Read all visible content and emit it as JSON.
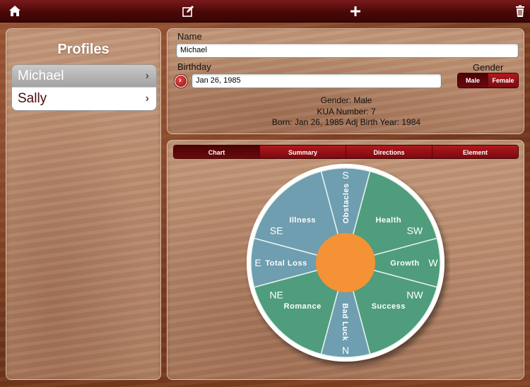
{
  "toolbar": {
    "icons": [
      "home-icon",
      "edit-icon",
      "add-icon",
      "trash-icon"
    ]
  },
  "profiles": {
    "title": "Profiles",
    "items": [
      {
        "label": "Michael",
        "selected": true
      },
      {
        "label": "Sally",
        "selected": false
      }
    ]
  },
  "form": {
    "name_label": "Name",
    "name_value": "Michael",
    "birthday_label": "Birthday",
    "birthday_value": "Jan 26, 1985",
    "gender_label": "Gender",
    "gender_options": [
      "Male",
      "Female"
    ],
    "gender_selected": "Male"
  },
  "info": {
    "line1": "Gender: Male",
    "line2": "KUA Number: 7",
    "line3": "Born: Jan 26, 1985  Adj Birth Year: 1984"
  },
  "tabs": {
    "items": [
      "Chart",
      "Summary",
      "Directions",
      "Element"
    ],
    "selected": "Chart"
  },
  "wheel": {
    "sectors": [
      {
        "dir": "S",
        "meaning": "Obstacles",
        "good": false
      },
      {
        "dir": "SW",
        "meaning": "Health",
        "good": true
      },
      {
        "dir": "W",
        "meaning": "Growth",
        "good": true
      },
      {
        "dir": "NW",
        "meaning": "Success",
        "good": true
      },
      {
        "dir": "N",
        "meaning": "Bad Luck",
        "good": false
      },
      {
        "dir": "NE",
        "meaning": "Romance",
        "good": true
      },
      {
        "dir": "E",
        "meaning": "Total Loss",
        "good": false
      },
      {
        "dir": "SE",
        "meaning": "Illness",
        "good": false
      }
    ],
    "colors": {
      "good": "#4f9d7c",
      "bad": "#6e9eb0",
      "center": "#f59235",
      "line": "#e8f3ec"
    }
  }
}
